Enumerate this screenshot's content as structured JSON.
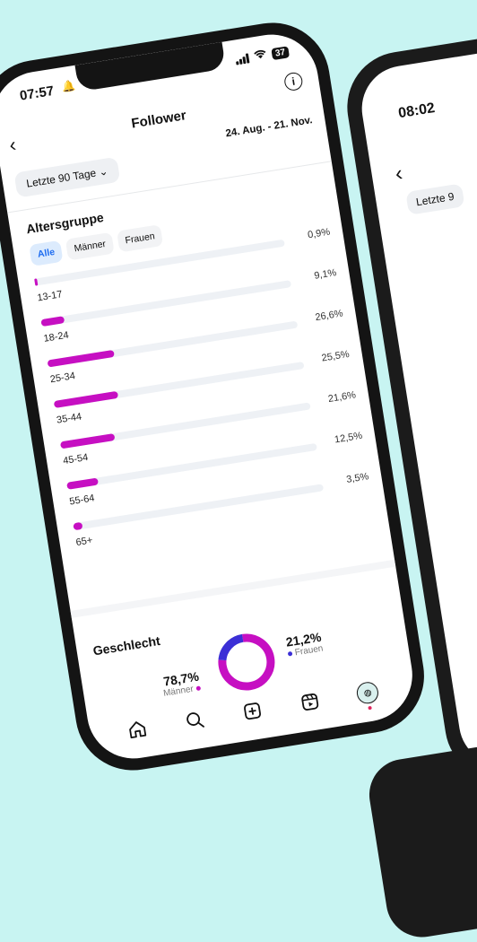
{
  "status": {
    "time": "07:57",
    "battery": "37"
  },
  "header": {
    "title": "Follower"
  },
  "filter": {
    "range_label": "Letzte 90 Tage",
    "date_range": "24. Aug. - 21. Nov."
  },
  "age": {
    "title": "Altersgruppe",
    "tabs": [
      "Alle",
      "Männer",
      "Frauen"
    ],
    "rows": [
      {
        "label": "13-17",
        "pct": "0,9%",
        "value": 0.9
      },
      {
        "label": "18-24",
        "pct": "9,1%",
        "value": 9.1
      },
      {
        "label": "25-34",
        "pct": "26,6%",
        "value": 26.6
      },
      {
        "label": "35-44",
        "pct": "25,5%",
        "value": 25.5
      },
      {
        "label": "45-54",
        "pct": "21,6%",
        "value": 21.6
      },
      {
        "label": "55-64",
        "pct": "12,5%",
        "value": 12.5
      },
      {
        "label": "65+",
        "pct": "3,5%",
        "value": 3.5
      }
    ],
    "bar_color": "#c60fc2"
  },
  "gender": {
    "title": "Geschlecht",
    "men": {
      "value": "78,7%",
      "label": "Männer",
      "percent": 78.7,
      "color": "#c60fc2"
    },
    "women": {
      "value": "21,2%",
      "label": "Frauen",
      "percent": 21.2,
      "color": "#3b2fd6"
    }
  },
  "second_phone": {
    "time": "08:02",
    "range_label": "Letzte 9"
  },
  "nav": [
    "home-icon",
    "search-icon",
    "create-icon",
    "reels-icon",
    "profile-avatar"
  ]
}
